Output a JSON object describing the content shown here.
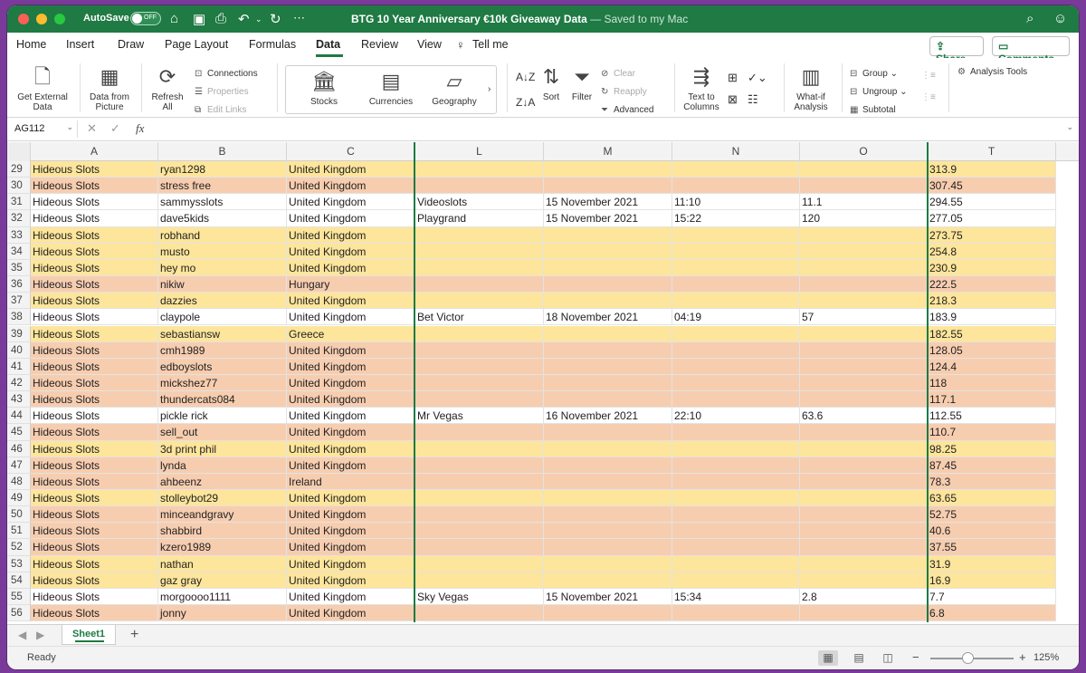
{
  "titlebar": {
    "autosave_label": "AutoSave",
    "autosave_state": "OFF",
    "doc_title": "BTG 10 Year Anniversary €10k Giveaway Data",
    "doc_saved": "— Saved to my Mac"
  },
  "menu": {
    "tabs": [
      "Home",
      "Insert",
      "Draw",
      "Page Layout",
      "Formulas",
      "Data",
      "Review",
      "View",
      "Tell me"
    ],
    "active": "Data",
    "share": "Share",
    "comments": "Comments"
  },
  "ribbon": {
    "get_external": "Get External Data",
    "data_from_picture": "Data from Picture",
    "refresh_all": "Refresh All",
    "connections": "Connections",
    "properties": "Properties",
    "edit_links": "Edit Links",
    "stocks": "Stocks",
    "currencies": "Currencies",
    "geography": "Geography",
    "sort": "Sort",
    "filter": "Filter",
    "clear": "Clear",
    "reapply": "Reapply",
    "advanced": "Advanced",
    "text_to_columns": "Text to Columns",
    "what_if": "What-if Analysis",
    "group": "Group",
    "ungroup": "Ungroup",
    "subtotal": "Subtotal",
    "analysis_tools": "Analysis Tools"
  },
  "formula_bar": {
    "name_box": "AG112",
    "fx": "fx",
    "formula": ""
  },
  "columns": [
    "A",
    "B",
    "C",
    "L",
    "M",
    "N",
    "O",
    "T"
  ],
  "rows": [
    {
      "n": "29",
      "bg": "y",
      "a": "Hideous Slots",
      "b": "ryan1298",
      "c": "United Kingdom",
      "l": "",
      "m": "",
      "nn": "",
      "o": "",
      "t": "313.9"
    },
    {
      "n": "30",
      "bg": "o",
      "a": "Hideous Slots",
      "b": "stress free",
      "c": "United Kingdom",
      "l": "",
      "m": "",
      "nn": "",
      "o": "",
      "t": "307.45"
    },
    {
      "n": "31",
      "bg": "w",
      "a": "Hideous Slots",
      "b": "sammysslots",
      "c": "United Kingdom",
      "l": "Videoslots",
      "m": "15 November 2021",
      "nn": "11:10",
      "o": "11.1",
      "t": "294.55"
    },
    {
      "n": "32",
      "bg": "w",
      "a": "Hideous Slots",
      "b": "dave5kids",
      "c": "United Kingdom",
      "l": "Playgrand",
      "m": "15 November 2021",
      "nn": "15:22",
      "o": "120",
      "t": "277.05"
    },
    {
      "n": "33",
      "bg": "y",
      "a": "Hideous Slots",
      "b": "robhand",
      "c": "United Kingdom",
      "l": "",
      "m": "",
      "nn": "",
      "o": "",
      "t": "273.75"
    },
    {
      "n": "34",
      "bg": "y",
      "a": "Hideous Slots",
      "b": "musto",
      "c": "United Kingdom",
      "l": "",
      "m": "",
      "nn": "",
      "o": "",
      "t": "254.8"
    },
    {
      "n": "35",
      "bg": "y",
      "a": "Hideous Slots",
      "b": "hey mo",
      "c": "United Kingdom",
      "l": "",
      "m": "",
      "nn": "",
      "o": "",
      "t": "230.9"
    },
    {
      "n": "36",
      "bg": "o",
      "a": "Hideous Slots",
      "b": "nikiw",
      "c": "Hungary",
      "l": "",
      "m": "",
      "nn": "",
      "o": "",
      "t": "222.5"
    },
    {
      "n": "37",
      "bg": "y",
      "a": "Hideous Slots",
      "b": "dazzies",
      "c": "United Kingdom",
      "l": "",
      "m": "",
      "nn": "",
      "o": "",
      "t": "218.3"
    },
    {
      "n": "38",
      "bg": "w",
      "a": "Hideous Slots",
      "b": "claypole",
      "c": "United Kingdom",
      "l": "Bet Victor",
      "m": "18 November 2021",
      "nn": "04:19",
      "o": "57",
      "t": "183.9"
    },
    {
      "n": "39",
      "bg": "y",
      "a": "Hideous Slots",
      "b": "sebastiansw",
      "c": "Greece",
      "l": "",
      "m": "",
      "nn": "",
      "o": "",
      "t": "182.55"
    },
    {
      "n": "40",
      "bg": "o",
      "a": "Hideous Slots",
      "b": "cmh1989",
      "c": "United Kingdom",
      "l": "",
      "m": "",
      "nn": "",
      "o": "",
      "t": "128.05"
    },
    {
      "n": "41",
      "bg": "o",
      "a": "Hideous Slots",
      "b": "edboyslots",
      "c": "United Kingdom",
      "l": "",
      "m": "",
      "nn": "",
      "o": "",
      "t": "124.4"
    },
    {
      "n": "42",
      "bg": "o",
      "a": "Hideous Slots",
      "b": "mickshez77",
      "c": "United Kingdom",
      "l": "",
      "m": "",
      "nn": "",
      "o": "",
      "t": "118"
    },
    {
      "n": "43",
      "bg": "o",
      "a": "Hideous Slots",
      "b": "thundercats084",
      "c": "United Kingdom",
      "l": "",
      "m": "",
      "nn": "",
      "o": "",
      "t": "117.1"
    },
    {
      "n": "44",
      "bg": "w",
      "a": "Hideous Slots",
      "b": "pickle rick",
      "c": "United Kingdom",
      "l": "Mr Vegas",
      "m": "16 November 2021",
      "nn": "22:10",
      "o": "63.6",
      "t": "112.55"
    },
    {
      "n": "45",
      "bg": "o",
      "a": "Hideous Slots",
      "b": "sell_out",
      "c": "United Kingdom",
      "l": "",
      "m": "",
      "nn": "",
      "o": "",
      "t": "110.7"
    },
    {
      "n": "46",
      "bg": "y",
      "a": "Hideous Slots",
      "b": "3d print phil",
      "c": "United Kingdom",
      "l": "",
      "m": "",
      "nn": "",
      "o": "",
      "t": "98.25"
    },
    {
      "n": "47",
      "bg": "o",
      "a": "Hideous Slots",
      "b": "lynda",
      "c": "United Kingdom",
      "l": "",
      "m": "",
      "nn": "",
      "o": "",
      "t": "87.45"
    },
    {
      "n": "48",
      "bg": "o",
      "a": "Hideous Slots",
      "b": "ahbeenz",
      "c": "Ireland",
      "l": "",
      "m": "",
      "nn": "",
      "o": "",
      "t": "78.3"
    },
    {
      "n": "49",
      "bg": "y",
      "a": "Hideous Slots",
      "b": "stolleybot29",
      "c": "United Kingdom",
      "l": "",
      "m": "",
      "nn": "",
      "o": "",
      "t": "63.65"
    },
    {
      "n": "50",
      "bg": "o",
      "a": "Hideous Slots",
      "b": "minceandgravy",
      "c": "United Kingdom",
      "l": "",
      "m": "",
      "nn": "",
      "o": "",
      "t": "52.75"
    },
    {
      "n": "51",
      "bg": "o",
      "a": "Hideous Slots",
      "b": "shabbird",
      "c": "United Kingdom",
      "l": "",
      "m": "",
      "nn": "",
      "o": "",
      "t": "40.6"
    },
    {
      "n": "52",
      "bg": "o",
      "a": "Hideous Slots",
      "b": "kzero1989",
      "c": "United Kingdom",
      "l": "",
      "m": "",
      "nn": "",
      "o": "",
      "t": "37.55"
    },
    {
      "n": "53",
      "bg": "y",
      "a": "Hideous Slots",
      "b": "nathan",
      "c": "United Kingdom",
      "l": "",
      "m": "",
      "nn": "",
      "o": "",
      "t": "31.9"
    },
    {
      "n": "54",
      "bg": "y",
      "a": "Hideous Slots",
      "b": "gaz gray",
      "c": "United Kingdom",
      "l": "",
      "m": "",
      "nn": "",
      "o": "",
      "t": "16.9"
    },
    {
      "n": "55",
      "bg": "w",
      "a": "Hideous Slots",
      "b": "morgoooo1111",
      "c": "United Kingdom",
      "l": "Sky Vegas",
      "m": "15 November 2021",
      "nn": "15:34",
      "o": "2.8",
      "t": "7.7"
    },
    {
      "n": "56",
      "bg": "o",
      "a": "Hideous Slots",
      "b": "jonny",
      "c": "United Kingdom",
      "l": "",
      "m": "",
      "nn": "",
      "o": "",
      "t": "6.8"
    }
  ],
  "sheets": {
    "active": "Sheet1",
    "add": "+"
  },
  "status": {
    "ready": "Ready",
    "zoom": "125%"
  },
  "colors": {
    "accent": "#1f7a44",
    "yellow_row": "#fde59b",
    "orange_row": "#f7cdb0"
  }
}
